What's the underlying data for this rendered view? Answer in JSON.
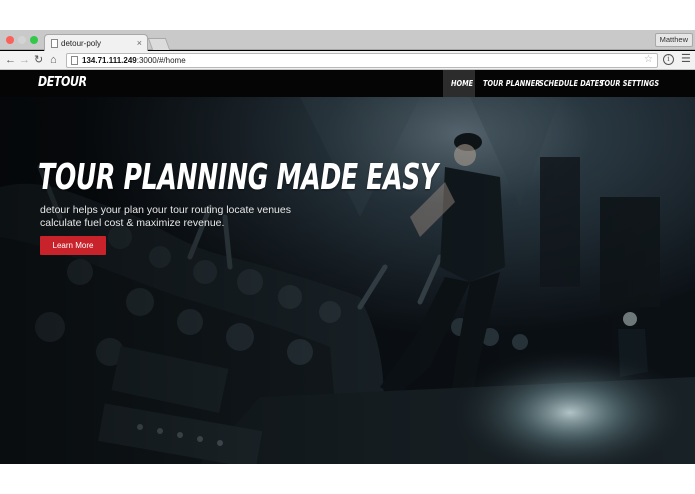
{
  "browser": {
    "tab_title": "detour-poly",
    "tab_close": "×",
    "profile_name": "Matthew",
    "url_host": "134.71.111.249",
    "url_rest": ":3000/#/home",
    "icons": [
      "back-icon",
      "forward-icon",
      "reload-icon",
      "home-icon",
      "page-icon",
      "star-icon",
      "info-icon",
      "menu-icon"
    ]
  },
  "site": {
    "logo": "DETOUR",
    "nav": [
      {
        "label": "HOME",
        "active": true
      },
      {
        "label": "TOUR PLANNER",
        "active": false
      },
      {
        "label": "SCHEDULE DATES",
        "active": false
      },
      {
        "label": "TOUR SETTINGS",
        "active": false
      }
    ]
  },
  "hero": {
    "headline": "TOUR PLANNING MADE EASY",
    "subtext": "detour helps your plan your tour routing locate venues calculate fuel cost & maximize revenue.",
    "cta_label": "Learn More",
    "image_description_icon": "concert-crowd-photo"
  },
  "colors": {
    "accent": "#c8232a",
    "navbar": "#050505",
    "nav_active": "#2c2c2c"
  }
}
